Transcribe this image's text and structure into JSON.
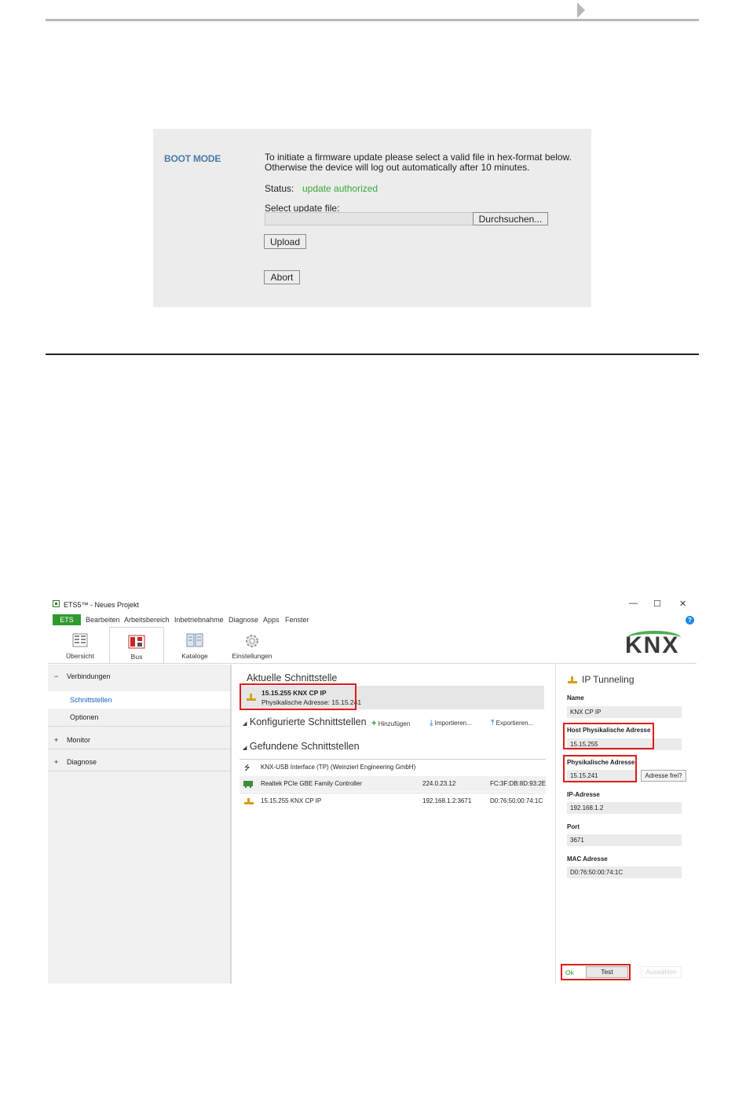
{
  "boot_panel": {
    "title": "BOOT MODE",
    "message_line1": "To initiate a firmware update please select a valid file in hex-format below.",
    "message_line2": "Otherwise the device will log out automatically after 10 minutes.",
    "status_label": "Status:",
    "status_value": "update authorized",
    "select_label": "Select update file:",
    "file_value": "",
    "browse_label": "Durchsuchen...",
    "upload_label": "Upload",
    "abort_label": "Abort"
  },
  "ets": {
    "title": "ETS5™ - Neues Projekt",
    "window_controls": {
      "minimize": "—",
      "maximize": "☐",
      "close": "✕"
    },
    "menu": {
      "ets": "ETS",
      "items": [
        "Bearbeiten",
        "Arbeitsbereich",
        "Inbetriebnahme",
        "Diagnose",
        "Apps",
        "Fenster"
      ]
    },
    "help": "?",
    "ribbon": [
      "Übersicht",
      "Bus",
      "Kataloge",
      "Einstellungen"
    ],
    "logo": "KNX",
    "nav": {
      "verbindungen": "Verbindungen",
      "schnittstellen": "Schnittstellen",
      "optionen": "Optionen",
      "monitor": "Monitor",
      "diagnose": "Diagnose",
      "minus": "−",
      "plus": "+"
    },
    "main": {
      "aktuelle_title": "Aktuelle Schnittstelle",
      "current_name": "15.15.255 KNX CP IP",
      "current_addr": "Physikalische Adresse: 15.15.241",
      "konfig_title": "Konfigurierte Schnittstellen",
      "hinzufuegen": "Hinzufügen",
      "importieren": "Importieren...",
      "exportieren": "Exportieren...",
      "gefundene_title": "Gefundene Schnittstellen",
      "found": [
        {
          "name": "KNX-USB Interface (TP) (Weinzierl Engineering GmbH)",
          "ip": "",
          "mac": ""
        },
        {
          "name": "Realtek PCIe GBE Family Controller",
          "ip": "224.0.23.12",
          "mac": "FC:3F:DB:8D:93:2E"
        },
        {
          "name": "15.15.255 KNX CP IP",
          "ip": "192.168.1.2:3671",
          "mac": "D0:76:50:00:74:1C"
        }
      ]
    },
    "props": {
      "title": "IP Tunneling",
      "name_label": "Name",
      "name_value": "KNX CP IP",
      "host_label": "Host Physikalische Adresse",
      "host_value": "15.15.255",
      "phys_label": "Physikalische Adresse",
      "phys_value": "15.15.241",
      "addr_free": "Adresse frei?",
      "ip_label": "IP-Adresse",
      "ip_value": "192.168.1.2",
      "port_label": "Port",
      "port_value": "3671",
      "mac_label": "MAC Adresse",
      "mac_value": "D0:76:50:00:74:1C",
      "ok": "Ok",
      "test": "Test",
      "auswaehlen": "Auswählen"
    }
  },
  "colors": {
    "accent_green": "#2e9a2e",
    "highlight_red": "#e01b1b",
    "boot_title": "#4a7ba7",
    "status_ok": "#3aa83a"
  }
}
